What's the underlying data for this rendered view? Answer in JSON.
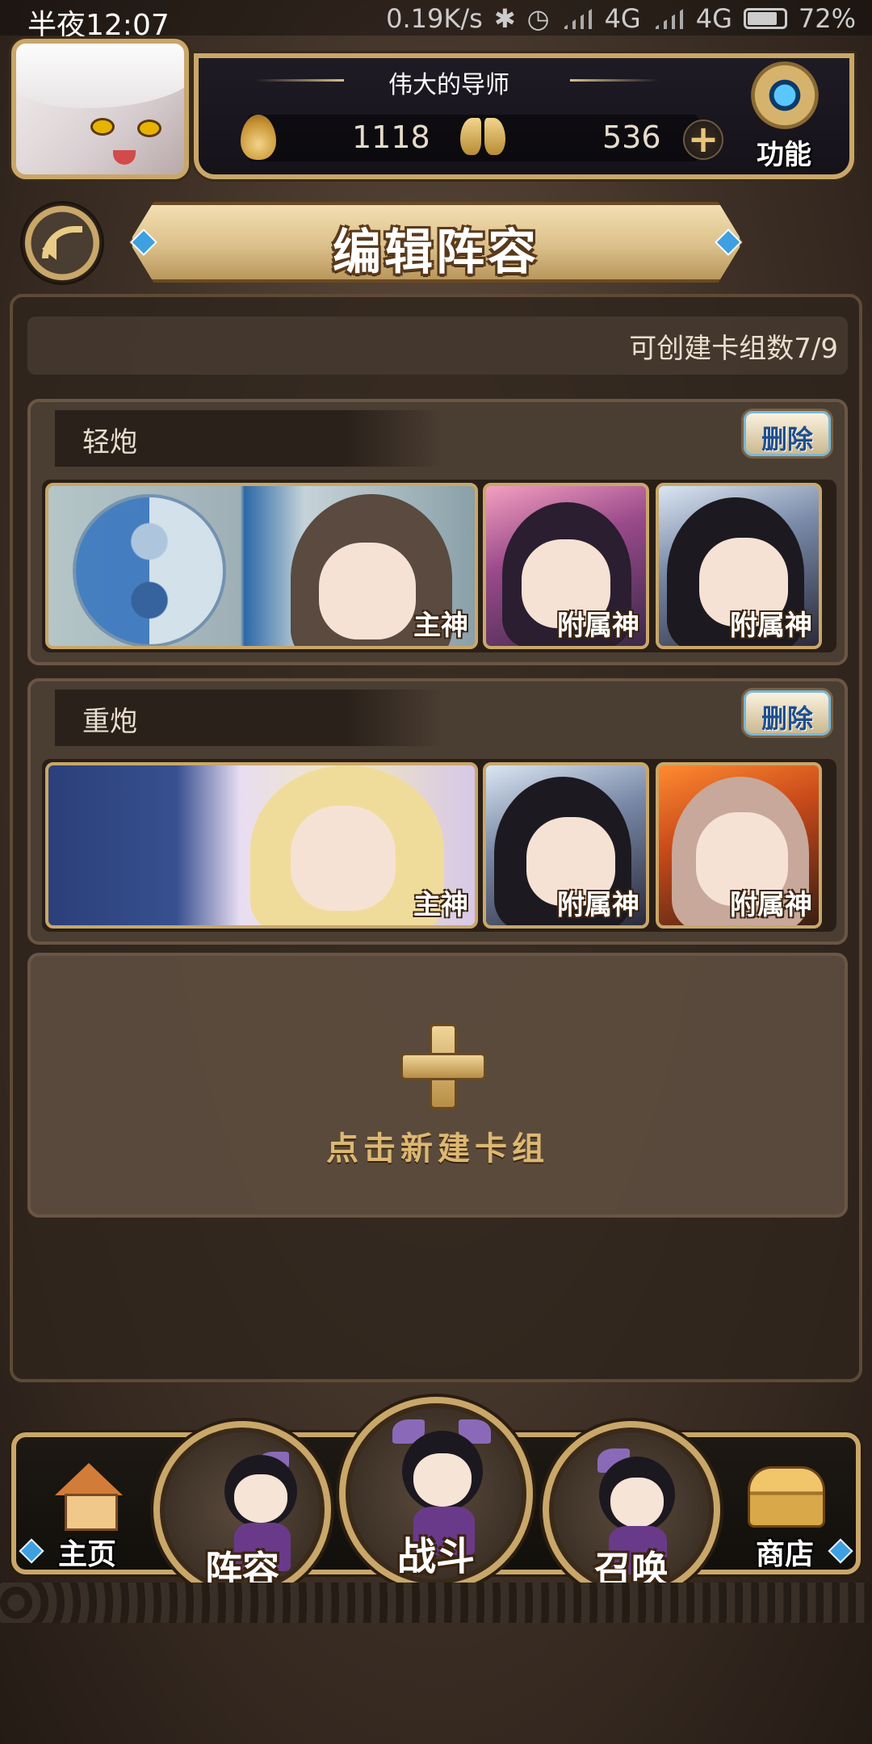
{
  "status_bar": {
    "time": "半夜12:07",
    "network_speed": "0.19K/s",
    "network_1": "4G",
    "network_2": "4G",
    "battery": "72%"
  },
  "player": {
    "name": "伟大的导师",
    "currency_1": "1118",
    "currency_2": "536"
  },
  "header": {
    "function_label": "功能",
    "page_title": "编辑阵容"
  },
  "deck_count": "可创建卡组数7/9",
  "decks": [
    {
      "name": "轻炮",
      "delete_label": "删除",
      "cards": [
        {
          "role": "主神"
        },
        {
          "role": "附属神"
        },
        {
          "role": "附属神"
        }
      ]
    },
    {
      "name": "重炮",
      "delete_label": "删除",
      "cards": [
        {
          "role": "主神"
        },
        {
          "role": "附属神"
        },
        {
          "role": "附属神"
        }
      ]
    }
  ],
  "new_deck_label": "点击新建卡组",
  "nav": {
    "home": "主页",
    "lineup": "阵容",
    "battle": "战斗",
    "summon": "召唤",
    "shop": "商店"
  },
  "icons": [
    "back-arrow-icon",
    "gear-icon",
    "flame-icon",
    "butterfly-icon",
    "plus-icon",
    "home-icon",
    "shop-icon"
  ],
  "colors": {
    "accent_gold": "#c9a769",
    "delete_text": "#1f4e8c",
    "panel_bg": "#4a3d32"
  }
}
